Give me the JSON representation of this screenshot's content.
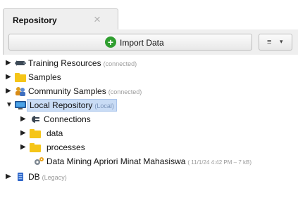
{
  "tab": {
    "title": "Repository",
    "close_symbol": "×"
  },
  "toolbar": {
    "import_label": "Import Data",
    "menu_symbol": "≡",
    "menu_caret": "▾"
  },
  "tree": {
    "items": [
      {
        "label": "Training Resources",
        "meta": "(connected)",
        "arrow": "▶",
        "icon": "training-resources-icon"
      },
      {
        "label": "Samples",
        "meta": "",
        "arrow": "▶",
        "icon": "folder-icon"
      },
      {
        "label": "Community Samples",
        "meta": "(connected)",
        "arrow": "▶",
        "icon": "community-icon"
      },
      {
        "label": "Local Repository",
        "meta": "(Local)",
        "arrow": "▼",
        "icon": "monitor-icon",
        "selected": true
      },
      {
        "label": "Connections",
        "meta": "",
        "arrow": "▶",
        "icon": "connections-icon"
      },
      {
        "label": "data",
        "meta": "",
        "arrow": "▶",
        "icon": "folder-icon"
      },
      {
        "label": "processes",
        "meta": "",
        "arrow": "▶",
        "icon": "folder-icon"
      },
      {
        "label": "Data Mining Apriori Minat Mahasiswa",
        "meta": "( 11/1/24 4:42 PM – 7 kB)",
        "arrow": "",
        "icon": "process-icon"
      },
      {
        "label": "DB",
        "meta": "(Legacy)",
        "arrow": "▶",
        "icon": "database-icon"
      }
    ]
  }
}
